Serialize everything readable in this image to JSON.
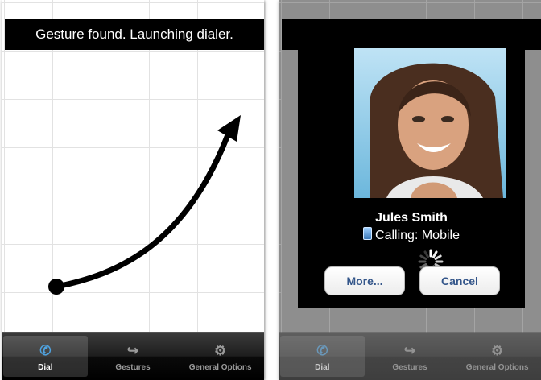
{
  "left_screen": {
    "banner_text": "Gesture found. Launching dialer."
  },
  "right_screen": {
    "caller_name": "Jules Smith",
    "call_status": "Calling: Mobile",
    "more_button": "More...",
    "cancel_button": "Cancel"
  },
  "tabbar": {
    "tabs": [
      {
        "label": "Dial",
        "icon": "phone-icon",
        "active": true
      },
      {
        "label": "Gestures",
        "icon": "gesture-icon",
        "active": false
      },
      {
        "label": "General Options",
        "icon": "gear-icon",
        "active": false
      }
    ]
  },
  "colors": {
    "tab_active_icon": "#4fa3e0",
    "button_text": "#34568a",
    "banner_bg": "#000000"
  }
}
